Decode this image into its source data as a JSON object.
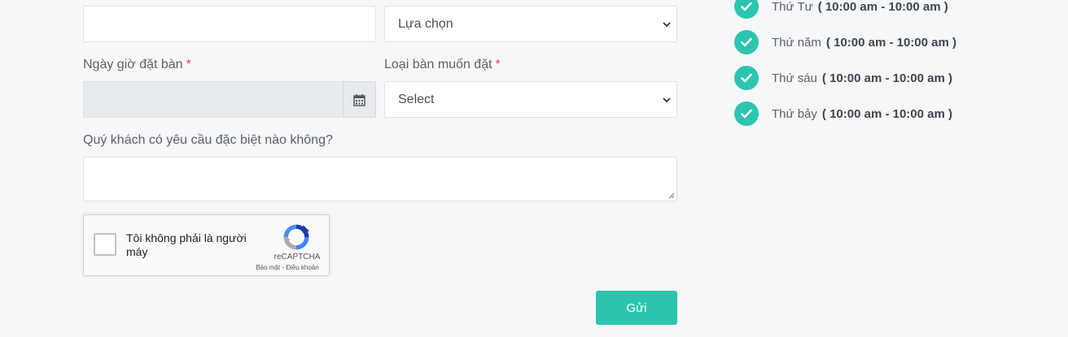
{
  "form": {
    "first_select": {
      "selected": "Lựa chọn"
    },
    "date_label": "Ngày giờ đặt bàn",
    "table_type_label": "Loại bàn muốn đặt",
    "required_mark": "*",
    "table_type_select": {
      "selected": "Select"
    },
    "special_request_label": "Quý khách có yêu cầu đặc biệt nào không?",
    "submit_label": "Gửi"
  },
  "recaptcha": {
    "text": "Tôi không phải là người máy",
    "brand": "reCAPTCHA",
    "links": "Bảo mật - Điều khoản"
  },
  "opening_hours": [
    {
      "day": "Thứ Tư",
      "time": "( 10:00 am - 10:00 am )"
    },
    {
      "day": "Thứ năm",
      "time": "( 10:00 am - 10:00 am )"
    },
    {
      "day": "Thứ sáu",
      "time": "( 10:00 am - 10:00 am )"
    },
    {
      "day": "Thứ bảy",
      "time": "( 10:00 am - 10:00 am )"
    }
  ],
  "icons": {
    "calendar": "calendar-icon",
    "check": "check-circle-icon",
    "chevron": "chevron-down-icon",
    "recaptcha": "recaptcha-logo"
  },
  "colors": {
    "accent": "#2bc5ad",
    "required": "#e24b4b",
    "background": "#f6f7f9"
  }
}
